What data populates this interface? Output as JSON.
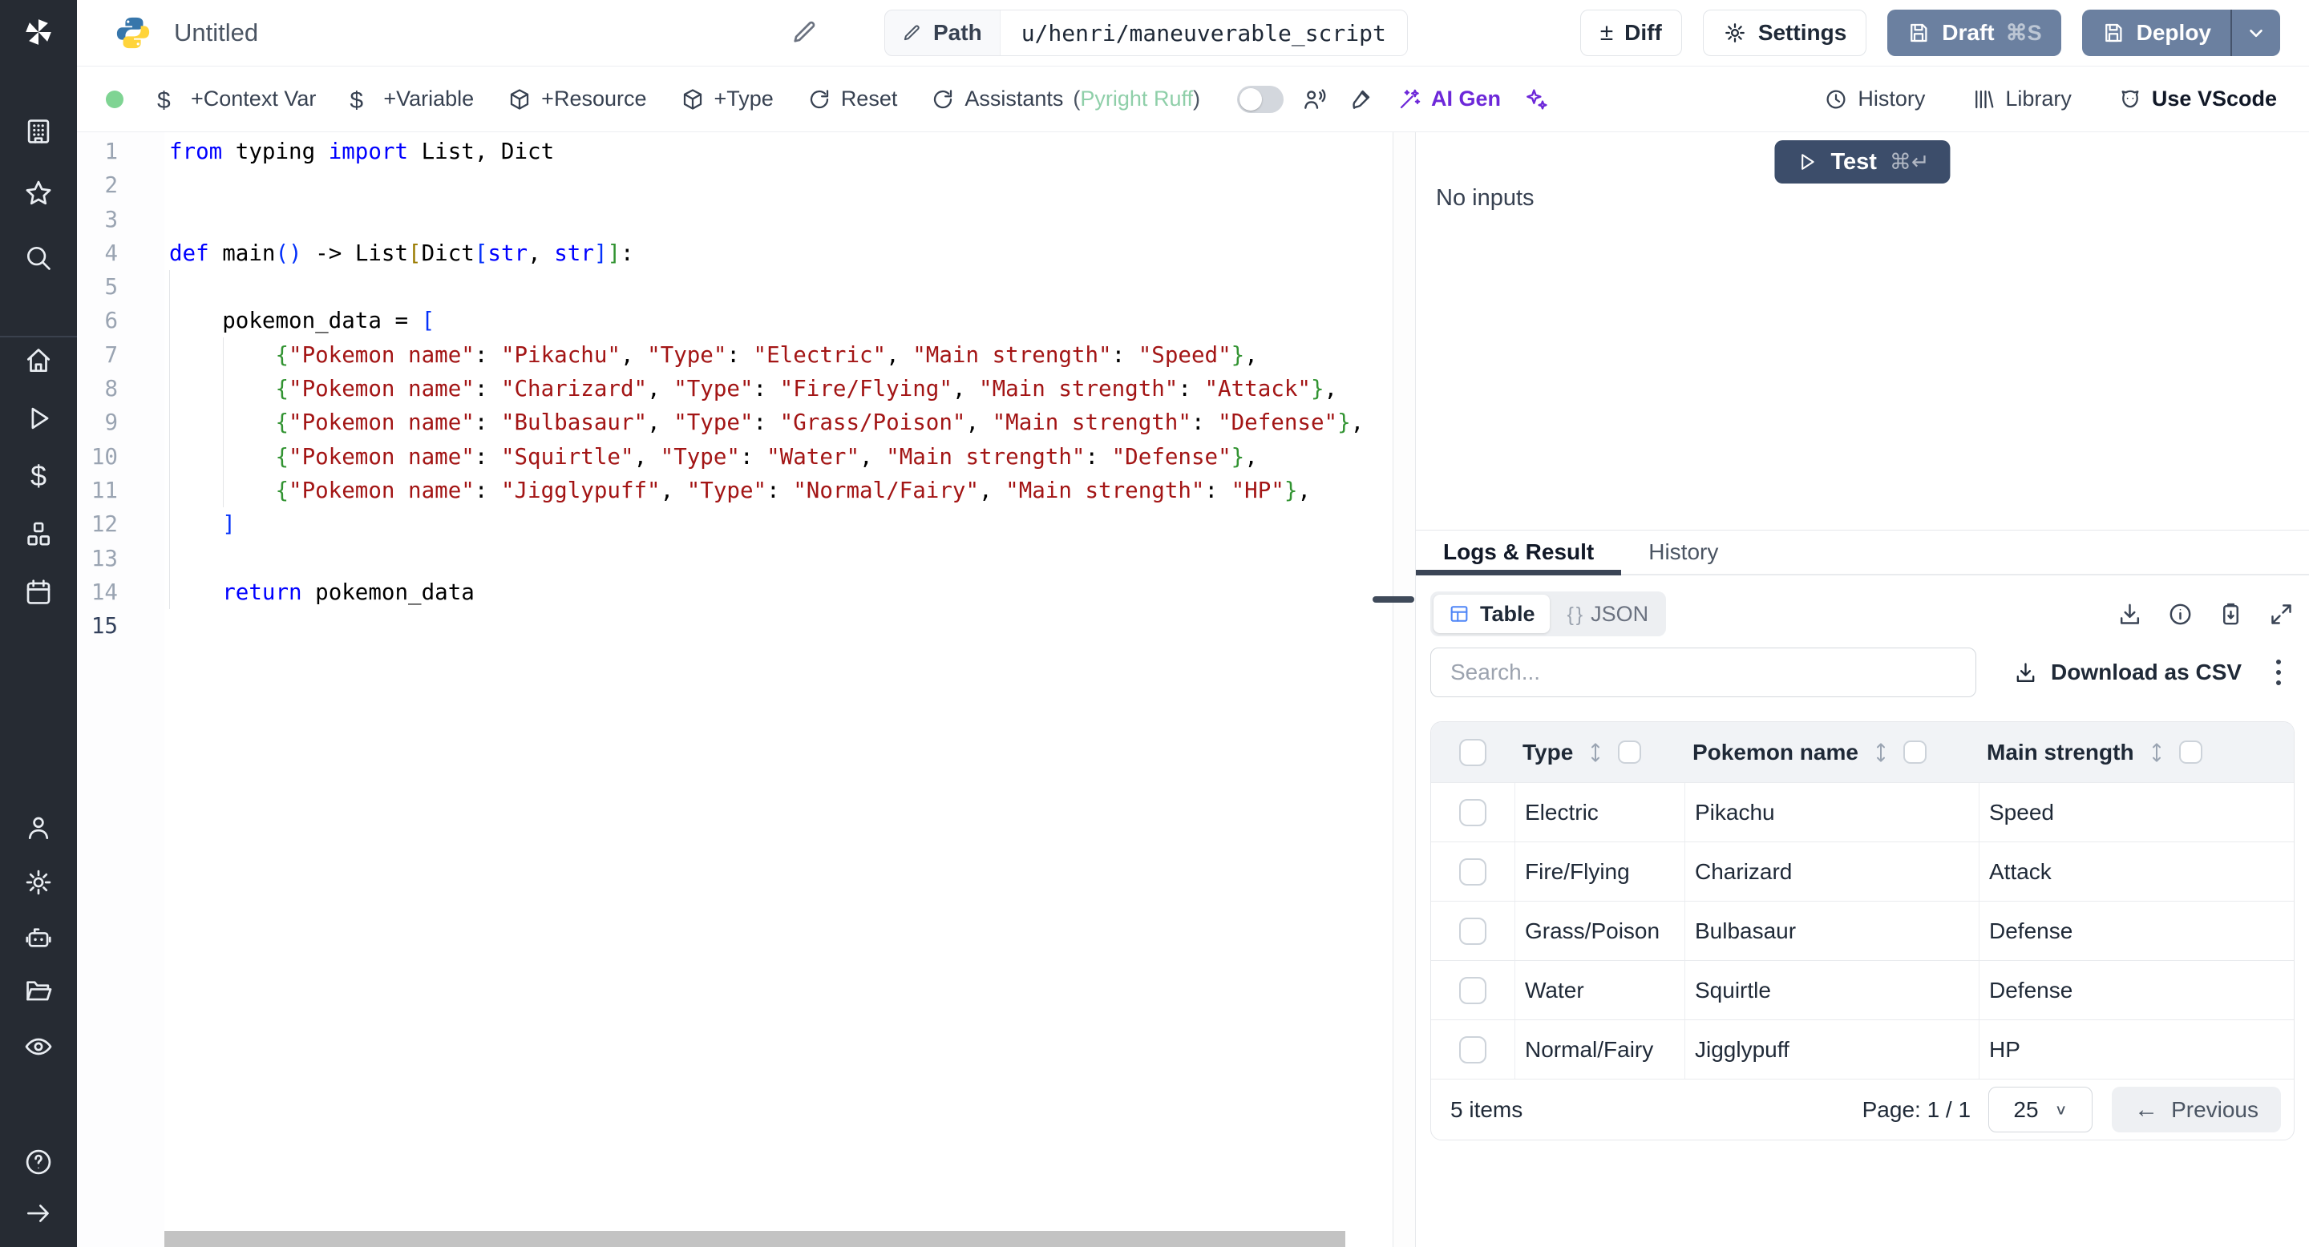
{
  "topbar": {
    "title": "Untitled",
    "path_label": "Path",
    "path_value": "u/henri/maneuverable_script",
    "diff_label": "Diff",
    "settings_label": "Settings",
    "draft_label": "Draft",
    "draft_shortcut": "⌘S",
    "deploy_label": "Deploy"
  },
  "toolbar": {
    "context_var": "+Context Var",
    "variable": "+Variable",
    "resource": "+Resource",
    "type": "+Type",
    "reset": "Reset",
    "assistants": "Assistants",
    "assistants_open": "(",
    "assistants_status": "Pyright Ruff",
    "assistants_close": ")",
    "ai_gen": "AI Gen",
    "history": "History",
    "library": "Library",
    "vscode": "Use VScode"
  },
  "sidebar": {
    "icons": [
      "windmill-logo",
      "workspace-building",
      "favorites-star",
      "search",
      "home",
      "runs-play",
      "variables-dollar",
      "resources-cubes",
      "schedules-calendar",
      "user",
      "settings-gear",
      "workers-robot",
      "folders",
      "audit-eye",
      "help",
      "expand-arrow"
    ]
  },
  "editor": {
    "language": "python",
    "active_line": 15,
    "lines": [
      {
        "n": 1,
        "segs": [
          [
            "k",
            "from"
          ],
          [
            "p",
            " typing "
          ],
          [
            "k",
            "import"
          ],
          [
            "p",
            " List, Dict"
          ]
        ]
      },
      {
        "n": 2,
        "segs": []
      },
      {
        "n": 3,
        "segs": []
      },
      {
        "n": 4,
        "segs": [
          [
            "k",
            "def"
          ],
          [
            "p",
            " main"
          ],
          [
            "bb",
            "()"
          ],
          [
            "p",
            " -> List"
          ],
          [
            "bg",
            "["
          ],
          [
            "p",
            "Dict"
          ],
          [
            "bb",
            "["
          ],
          [
            "k",
            "str"
          ],
          [
            "p",
            ", "
          ],
          [
            "k",
            "str"
          ],
          [
            "bb",
            "]"
          ],
          [
            "bgr",
            "]"
          ],
          [
            "p",
            ":"
          ]
        ]
      },
      {
        "n": 5,
        "segs": []
      },
      {
        "n": 6,
        "segs": [
          [
            "p",
            "    pokemon_data = "
          ],
          [
            "bb",
            "["
          ]
        ]
      },
      {
        "n": 7,
        "segs": [
          [
            "p",
            "        "
          ],
          [
            "bgr",
            "{"
          ],
          [
            "s",
            "\"Pokemon name\""
          ],
          [
            "p",
            ": "
          ],
          [
            "s",
            "\"Pikachu\""
          ],
          [
            "p",
            ", "
          ],
          [
            "s",
            "\"Type\""
          ],
          [
            "p",
            ": "
          ],
          [
            "s",
            "\"Electric\""
          ],
          [
            "p",
            ", "
          ],
          [
            "s",
            "\"Main strength\""
          ],
          [
            "p",
            ": "
          ],
          [
            "s",
            "\"Speed\""
          ],
          [
            "bgr",
            "}"
          ],
          [
            "p",
            ","
          ]
        ]
      },
      {
        "n": 8,
        "segs": [
          [
            "p",
            "        "
          ],
          [
            "bgr",
            "{"
          ],
          [
            "s",
            "\"Pokemon name\""
          ],
          [
            "p",
            ": "
          ],
          [
            "s",
            "\"Charizard\""
          ],
          [
            "p",
            ", "
          ],
          [
            "s",
            "\"Type\""
          ],
          [
            "p",
            ": "
          ],
          [
            "s",
            "\"Fire/Flying\""
          ],
          [
            "p",
            ", "
          ],
          [
            "s",
            "\"Main strength\""
          ],
          [
            "p",
            ": "
          ],
          [
            "s",
            "\"Attack\""
          ],
          [
            "bgr",
            "}"
          ],
          [
            "p",
            ","
          ]
        ]
      },
      {
        "n": 9,
        "segs": [
          [
            "p",
            "        "
          ],
          [
            "bgr",
            "{"
          ],
          [
            "s",
            "\"Pokemon name\""
          ],
          [
            "p",
            ": "
          ],
          [
            "s",
            "\"Bulbasaur\""
          ],
          [
            "p",
            ", "
          ],
          [
            "s",
            "\"Type\""
          ],
          [
            "p",
            ": "
          ],
          [
            "s",
            "\"Grass/Poison\""
          ],
          [
            "p",
            ", "
          ],
          [
            "s",
            "\"Main strength\""
          ],
          [
            "p",
            ": "
          ],
          [
            "s",
            "\"Defense\""
          ],
          [
            "bgr",
            "}"
          ],
          [
            "p",
            ","
          ]
        ]
      },
      {
        "n": 10,
        "segs": [
          [
            "p",
            "        "
          ],
          [
            "bgr",
            "{"
          ],
          [
            "s",
            "\"Pokemon name\""
          ],
          [
            "p",
            ": "
          ],
          [
            "s",
            "\"Squirtle\""
          ],
          [
            "p",
            ", "
          ],
          [
            "s",
            "\"Type\""
          ],
          [
            "p",
            ": "
          ],
          [
            "s",
            "\"Water\""
          ],
          [
            "p",
            ", "
          ],
          [
            "s",
            "\"Main strength\""
          ],
          [
            "p",
            ": "
          ],
          [
            "s",
            "\"Defense\""
          ],
          [
            "bgr",
            "}"
          ],
          [
            "p",
            ","
          ]
        ]
      },
      {
        "n": 11,
        "segs": [
          [
            "p",
            "        "
          ],
          [
            "bgr",
            "{"
          ],
          [
            "s",
            "\"Pokemon name\""
          ],
          [
            "p",
            ": "
          ],
          [
            "s",
            "\"Jigglypuff\""
          ],
          [
            "p",
            ", "
          ],
          [
            "s",
            "\"Type\""
          ],
          [
            "p",
            ": "
          ],
          [
            "s",
            "\"Normal/Fairy\""
          ],
          [
            "p",
            ", "
          ],
          [
            "s",
            "\"Main strength\""
          ],
          [
            "p",
            ": "
          ],
          [
            "s",
            "\"HP\""
          ],
          [
            "bgr",
            "}"
          ],
          [
            "p",
            ","
          ]
        ]
      },
      {
        "n": 12,
        "segs": [
          [
            "p",
            "    "
          ],
          [
            "bb",
            "]"
          ]
        ]
      },
      {
        "n": 13,
        "segs": []
      },
      {
        "n": 14,
        "segs": [
          [
            "p",
            "    "
          ],
          [
            "k",
            "return"
          ],
          [
            "p",
            " pokemon_data"
          ]
        ]
      },
      {
        "n": 15,
        "segs": [],
        "active": true
      }
    ]
  },
  "run": {
    "test_label": "Test",
    "test_shortcut": "⌘↵",
    "no_inputs": "No inputs"
  },
  "result": {
    "tab_logs": "Logs & Result",
    "tab_history": "History",
    "view_table": "Table",
    "view_json": "JSON",
    "search_placeholder": "Search...",
    "download_csv": "Download as CSV",
    "table": {
      "columns": [
        "Type",
        "Pokemon name",
        "Main strength"
      ],
      "rows": [
        [
          "Electric",
          "Pikachu",
          "Speed"
        ],
        [
          "Fire/Flying",
          "Charizard",
          "Attack"
        ],
        [
          "Grass/Poison",
          "Bulbasaur",
          "Defense"
        ],
        [
          "Water",
          "Squirtle",
          "Defense"
        ],
        [
          "Normal/Fairy",
          "Jigglypuff",
          "HP"
        ]
      ]
    },
    "footer": {
      "items": "5 items",
      "page": "Page: 1 / 1",
      "page_size": "25",
      "previous": "Previous"
    }
  },
  "colors": {
    "accent_frost": "#6b80a0",
    "test_navy": "#3c4d6a",
    "ai_purple": "#6d28d9",
    "status_green": "#7fd493",
    "assistants_green": "#8fcfa9",
    "table_icon_blue": "#4f86f7",
    "string_red": "#a31515",
    "keyword_blue": "#0000ff"
  }
}
